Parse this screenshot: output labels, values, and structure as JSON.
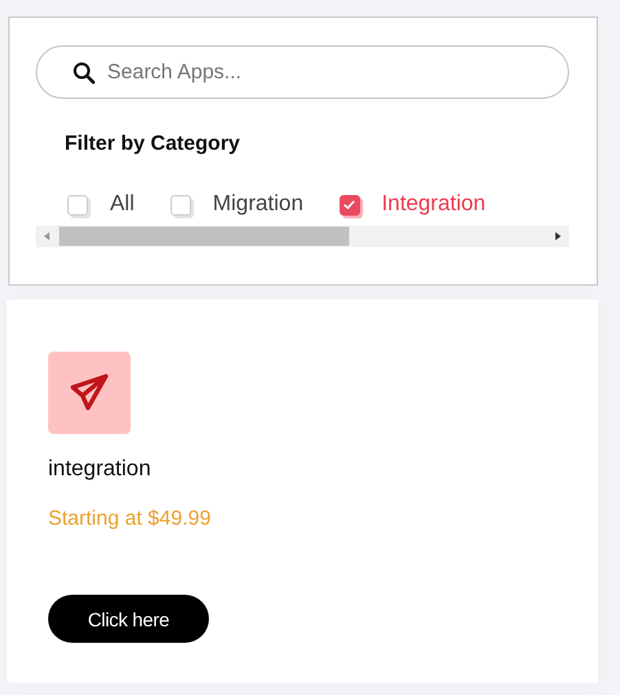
{
  "search": {
    "placeholder": "Search Apps..."
  },
  "filter": {
    "title": "Filter by Category",
    "categories": [
      {
        "label": "All",
        "selected": false
      },
      {
        "label": "Migration",
        "selected": false
      },
      {
        "label": "Integration",
        "selected": true
      }
    ]
  },
  "card": {
    "title": "integration",
    "price": "Starting at $49.99",
    "button": "Click here"
  }
}
